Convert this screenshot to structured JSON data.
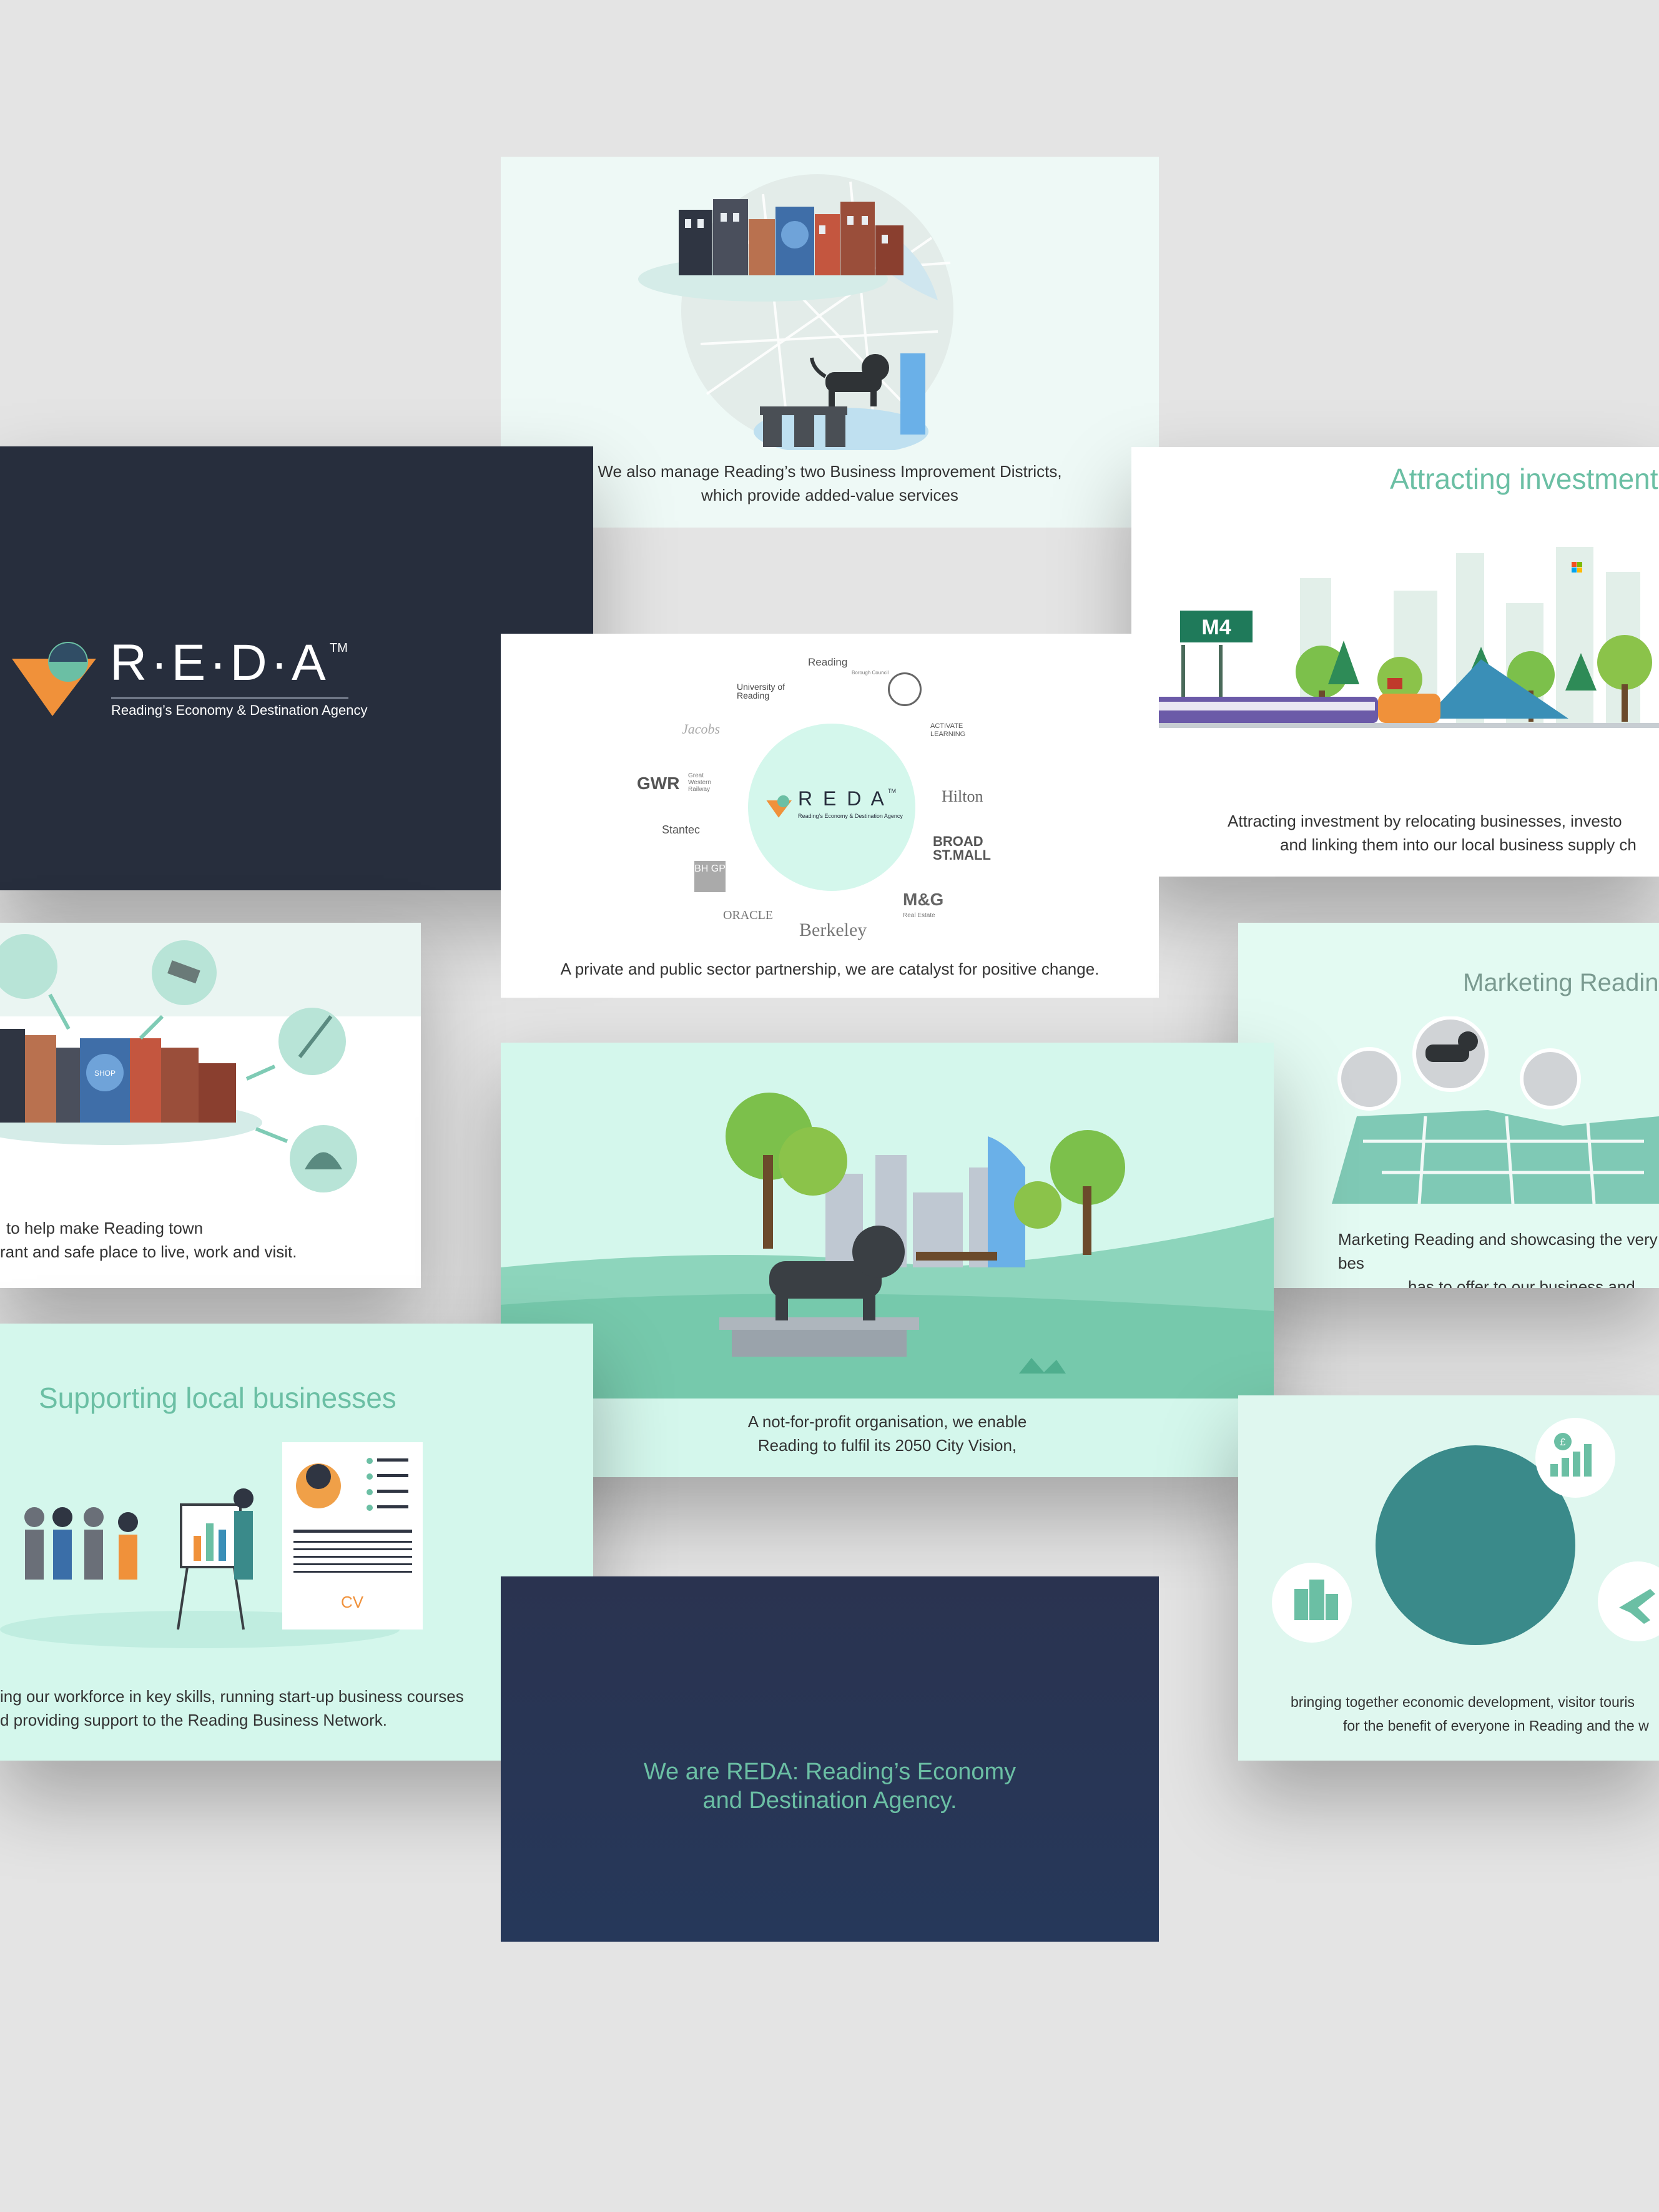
{
  "colors": {
    "background": "#e4e4e4",
    "navy": "#272e3d",
    "deep_navy": "#26385a",
    "mint": "#d4f7ec",
    "mint_light": "#eef9f6",
    "teal_accent": "#6bbfa4",
    "teal_dark": "#3a8a8a",
    "orange": "#f0913a"
  },
  "slides": {
    "bid": {
      "caption_line1": "We also manage Reading’s two Business Improvement Districts,",
      "caption_line2": "which provide added-value services"
    },
    "logo_slide": {
      "wordmark": "R·E·D·A",
      "tm": "TM",
      "tagline": "Reading’s Economy & Destination Agency"
    },
    "investment": {
      "title": "Attracting investment",
      "sign": "M4",
      "caption_line1": "Attracting investment by relocating businesses, investo",
      "caption_line2": "and linking them into our local business supply ch"
    },
    "partners": {
      "center_wordmark": "R E D A",
      "center_tm": "TM",
      "center_tagline": "Reading’s Economy & Destination Agency",
      "logos": {
        "university": "University of Reading",
        "reading_council": "Reading",
        "reading_council_sub": "Borough Council",
        "jacobs": "Jacobs",
        "gwr": "GWR",
        "gwr_sub": "Great Western Railway",
        "stantec": "Stantec",
        "bhgp": "BH GP",
        "oracle": "ORACLE",
        "berkeley": "Berkeley",
        "activate": "ACTIVATE LEARNING",
        "hilton": "Hilton",
        "broad_street": "BROAD ST.MALL",
        "mg": "M&G",
        "mg_sub": "Real Estate"
      },
      "caption": "A private and public sector partnership, we are catalyst for positive change."
    },
    "town": {
      "caption_line1": "to help make Reading town",
      "caption_line2": "rant and safe place to live, work and visit.",
      "shop_label": "SHOP"
    },
    "marketing": {
      "title": "Marketing Reading",
      "caption_line1": "Marketing Reading and showcasing the very bes",
      "caption_line2": "has to offer to our business and leisur"
    },
    "vision": {
      "caption_line1": "A not-for-profit organisation, we enable",
      "caption_line2": "Reading to fulfil its 2050 City Vision,"
    },
    "supporting": {
      "title": "Supporting local businesses",
      "cv_label": "CV",
      "caption_line1": "ing our workforce in key skills, running start-up business courses",
      "caption_line2": "d providing support to the Reading Business Network."
    },
    "bringing": {
      "caption_line1": "bringing together economic development, visitor touris",
      "caption_line2": "for the benefit of everyone in Reading and the w",
      "pound_symbol": "£"
    },
    "we_are": {
      "line1": "We are REDA: Reading’s Economy",
      "line2": "and Destination Agency."
    }
  }
}
